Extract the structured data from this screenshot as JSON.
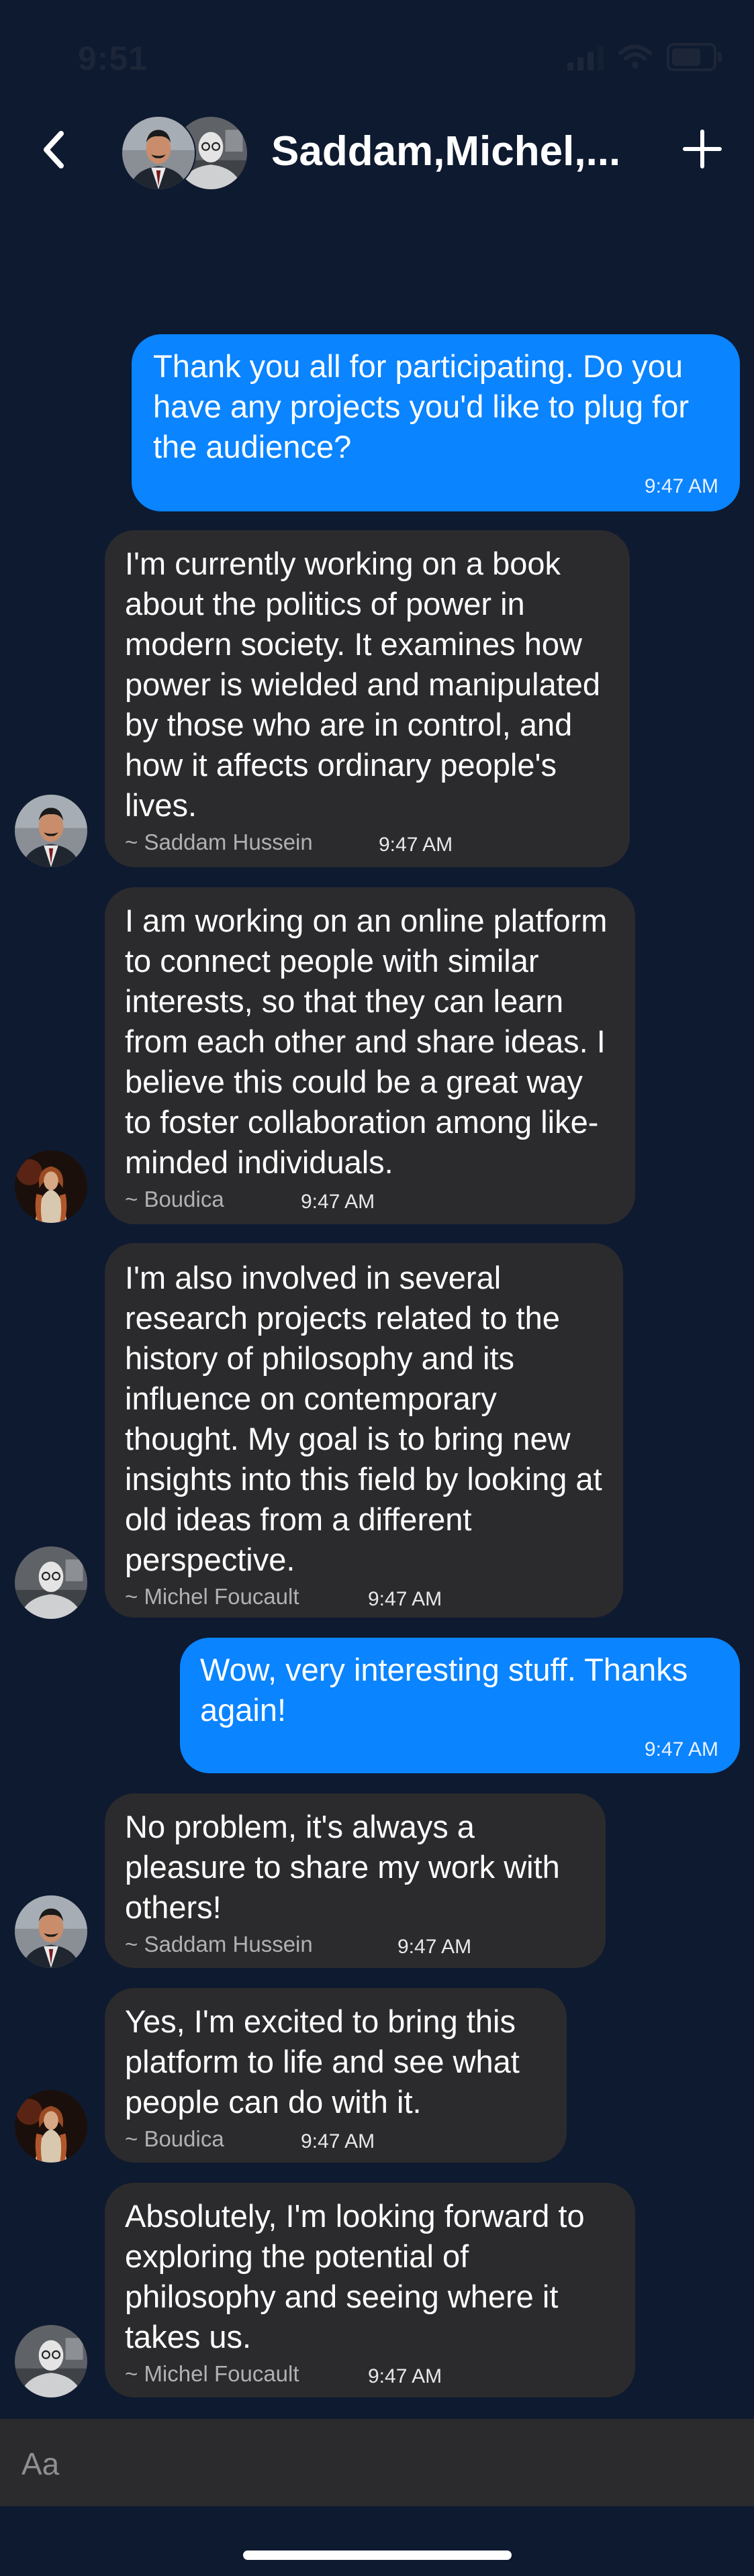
{
  "status_bar": {
    "time": "9:51"
  },
  "header": {
    "title": "Saddam,Michel,...",
    "icons": {
      "back": "chevron-left-icon",
      "add": "plus-icon"
    }
  },
  "messages": [
    {
      "direction": "outgoing",
      "text": "Thank you all for participating. Do you have any projects you'd like to plug for the audience?",
      "time": "9:47 AM"
    },
    {
      "direction": "incoming",
      "text": "I'm currently working on a book about the politics of power in modern society. It examines how power is wielded and manipulated by those who are in control, and how it affects ordinary people's lives.",
      "sender": "~ Saddam Hussein",
      "time": "9:47 AM"
    },
    {
      "direction": "incoming",
      "text": "I am working on an online platform to connect people with similar interests, so that they can learn from each other and share ideas. I believe this could be a great way to foster collaboration among like-minded individuals.",
      "sender": "~ Boudica",
      "time": "9:47 AM"
    },
    {
      "direction": "incoming",
      "text": "I'm also involved in several research projects related to the history of philosophy and its influence on contemporary thought. My goal is to bring new insights into this field by looking at old ideas from a different perspective.",
      "sender": "~ Michel Foucault",
      "time": "9:47 AM"
    },
    {
      "direction": "outgoing",
      "text": "Wow, very interesting stuff. Thanks again!",
      "time": "9:47 AM"
    },
    {
      "direction": "incoming",
      "text": "No problem, it's always a pleasure to share my work with others!",
      "sender": "~ Saddam Hussein",
      "time": "9:47 AM"
    },
    {
      "direction": "incoming",
      "text": "Yes, I'm excited to bring this platform to life and see what people can do with it.",
      "sender": "~ Boudica",
      "time": "9:47 AM"
    },
    {
      "direction": "incoming",
      "text": "Absolutely, I'm looking forward to exploring the potential of philosophy and seeing where it takes us.",
      "sender": "~ Michel Foucault",
      "time": "9:47 AM"
    }
  ],
  "composer": {
    "placeholder": "Aa"
  },
  "colors": {
    "background": "#0e1a30",
    "outgoing_bubble": "#0a84ff",
    "incoming_bubble": "#2b2b2d",
    "sender_text": "#b1b1b5"
  }
}
